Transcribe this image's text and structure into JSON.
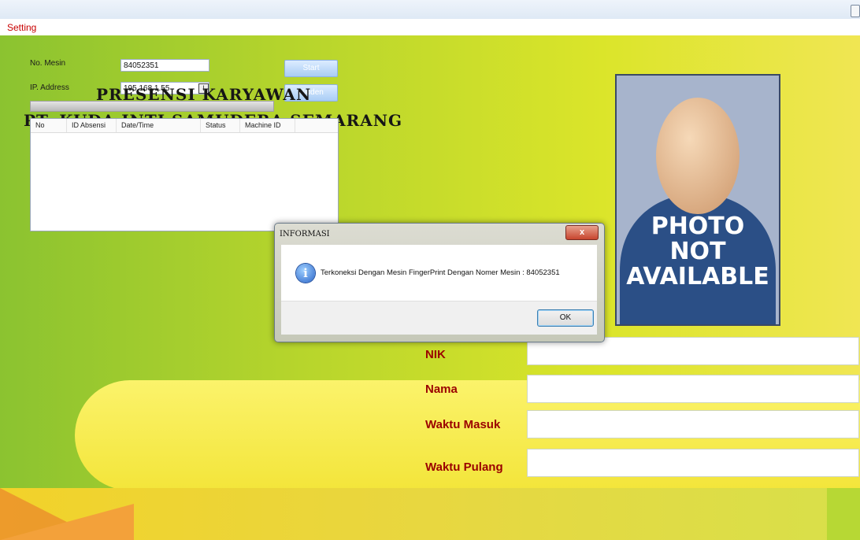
{
  "menu": {
    "setting_label": "Setting"
  },
  "form": {
    "no_mesin_label": "No. Mesin",
    "no_mesin_value": "84052351",
    "ip_label": "IP. Address",
    "ip_value": "195.168.1.55",
    "ip_icon_glyph": "I",
    "start_label": "Start",
    "hidden_label": "Hidden"
  },
  "heading": {
    "line1": "PRESENSI KARYAWAN",
    "line2": "PT. KUDA INTI SAMUDERA SEMARANG"
  },
  "table": {
    "columns": [
      "No",
      "ID Absensi",
      "Date/Time",
      "Status",
      "Machine ID"
    ]
  },
  "photo": {
    "line1": "PHOTO",
    "line2": "NOT",
    "line3": "AVAILABLE"
  },
  "fields": {
    "nik_label": "NIK",
    "nama_label": "Nama",
    "waktu_masuk_label": "Waktu Masuk",
    "waktu_pulang_label": "Waktu Pulang"
  },
  "dialog": {
    "title": "INFORMASI",
    "close_glyph": "x",
    "info_glyph": "i",
    "message": "Terkoneksi Dengan Mesin FingerPrint Dengan Nomer Mesin : 84052351",
    "ok_label": "OK"
  },
  "colors": {
    "accent_label": "#9a0000",
    "menu_text": "#c80000"
  }
}
